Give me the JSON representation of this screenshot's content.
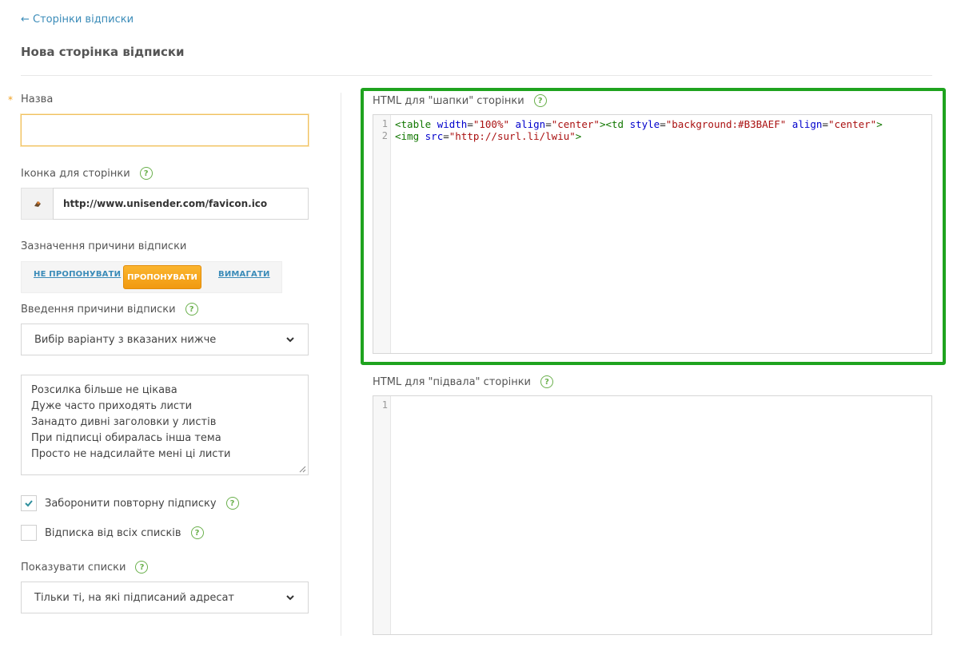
{
  "nav": {
    "back_label": "← Сторінки відписки"
  },
  "page": {
    "title": "Нова сторінка відписки"
  },
  "form": {
    "name": {
      "label": "Назва",
      "required_mark": "*",
      "value": ""
    },
    "icon": {
      "label": "Іконка для сторінки",
      "url": "http://www.unisender.com/favicon.ico"
    },
    "reason_mode": {
      "label": "Зазначення причини відписки",
      "options": [
        "НЕ ПРОПОНУВАТИ",
        "ПРОПОНУВАТИ",
        "ВИМАГАТИ"
      ],
      "selected": "ПРОПОНУВАТИ"
    },
    "reason_input": {
      "label": "Введення причини відписки",
      "selected": "Вибір варіанту з вказаних нижче"
    },
    "reasons": [
      "Розсилка більше не цікава",
      "Дуже часто приходять листи",
      "Занадто дивні заголовки у листів",
      "При підписці обиралась інша тема",
      "Просто не надсилайте мені ці листи"
    ],
    "forbid_resubscribe": {
      "label": "Заборонити повторну підписку",
      "checked": true
    },
    "unsubscribe_all": {
      "label": "Відписка від всіх списків",
      "checked": false
    },
    "show_lists": {
      "label": "Показувати списки",
      "selected": "Тільки ті, на які підписаний адресат"
    }
  },
  "header_html": {
    "label": "HTML для \"шапки\" сторінки",
    "line_numbers": [
      "1",
      "2"
    ],
    "line1": {
      "p1": "<table ",
      "a1": "width",
      "e1": "=",
      "s1": "\"100%\"",
      "sp1": " ",
      "a2": "align",
      "e2": "=",
      "s2": "\"center\"",
      "p2": "><td ",
      "a3": "style",
      "e3": "=",
      "s3": "\"background:#B3BAEF\"",
      "sp2": " ",
      "a4": "align",
      "e4": "=",
      "s4": "\"center\"",
      "p3": ">"
    },
    "line2": {
      "p1": "<img ",
      "a1": "src",
      "e1": "=",
      "s1": "\"http://surl.li/lwiu\"",
      "p2": ">"
    }
  },
  "footer_html": {
    "label": "HTML для \"підвала\" сторінки",
    "line_numbers": [
      "1"
    ]
  },
  "help_symbol": "?",
  "colors": {
    "accent_green": "#1fa31f",
    "button_orange": "#f5a41c",
    "link_blue": "#3a8bb8"
  }
}
